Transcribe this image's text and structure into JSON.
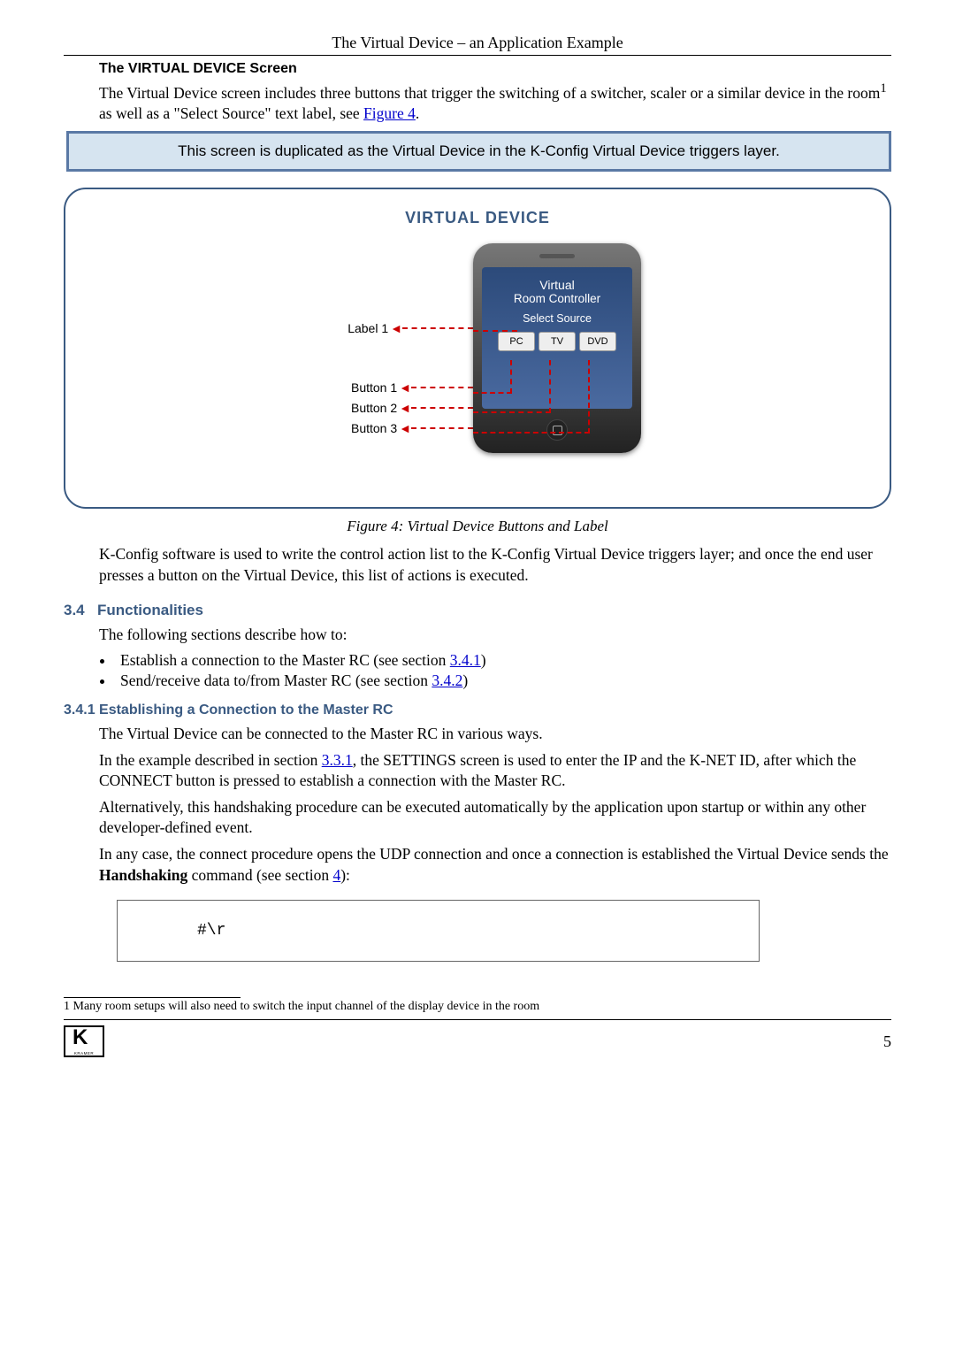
{
  "header": {
    "running": "The Virtual Device – an Application Example"
  },
  "vdscreen": {
    "heading": "The VIRTUAL DEVICE Screen",
    "para_before_ref": "The Virtual Device screen includes three buttons that trigger the switching of a switcher, scaler or a similar device in the room",
    "sup": "1",
    "para_mid": " as well as a \"Select Source\" text label, see ",
    "figref": "Figure 4",
    "para_end": ".",
    "note": "This screen is duplicated as the Virtual Device in the K-Config Virtual Device triggers layer."
  },
  "figure": {
    "title": "VIRTUAL DEVICE",
    "labels": {
      "label1": "Label 1",
      "b1": "Button 1",
      "b2": "Button 2",
      "b3": "Button 3"
    },
    "phone": {
      "line1": "Virtual",
      "line2": "Room Controller",
      "source": "Select Source",
      "btns": [
        "PC",
        "TV",
        "DVD"
      ]
    },
    "caption": "Figure 4: Virtual Device Buttons and Label"
  },
  "post_figure": "K-Config software is used to write the control action list to the K-Config Virtual Device triggers layer; and once the end user presses a button on the Virtual Device, this list of actions is executed.",
  "s34": {
    "num": "3.4",
    "title": "Functionalities",
    "intro": "The following sections describe how to:",
    "items": [
      {
        "text_a": "Establish a connection to the Master RC (see section ",
        "link": "3.4.1",
        "text_b": ")"
      },
      {
        "text_a": "Send/receive data to/from Master RC (see section ",
        "link": "3.4.2",
        "text_b": ")"
      }
    ]
  },
  "s341": {
    "heading": "3.4.1 Establishing a Connection to the Master RC",
    "p1": "The Virtual Device can be connected to the Master RC in various ways.",
    "p2a": "In the example described in section ",
    "p2link": "3.3.1",
    "p2b": ", the SETTINGS screen is used to enter the IP and the K-NET ID, after which the CONNECT button is pressed to establish a connection with the Master RC.",
    "p3": "Alternatively, this handshaking procedure can be executed automatically by the application upon startup or within any other developer-defined event.",
    "p4a": "In any case, the connect procedure opens the UDP connection and once a connection is established the Virtual Device sends the ",
    "p4bold": "Handshaking",
    "p4b": " command (see section ",
    "p4link": "4",
    "p4c": "):",
    "code": "#\\r"
  },
  "footnote": "1 Many room setups will also need to switch the input channel of the display device in the room",
  "footer": {
    "brand": "KRAMER",
    "page": "5"
  }
}
